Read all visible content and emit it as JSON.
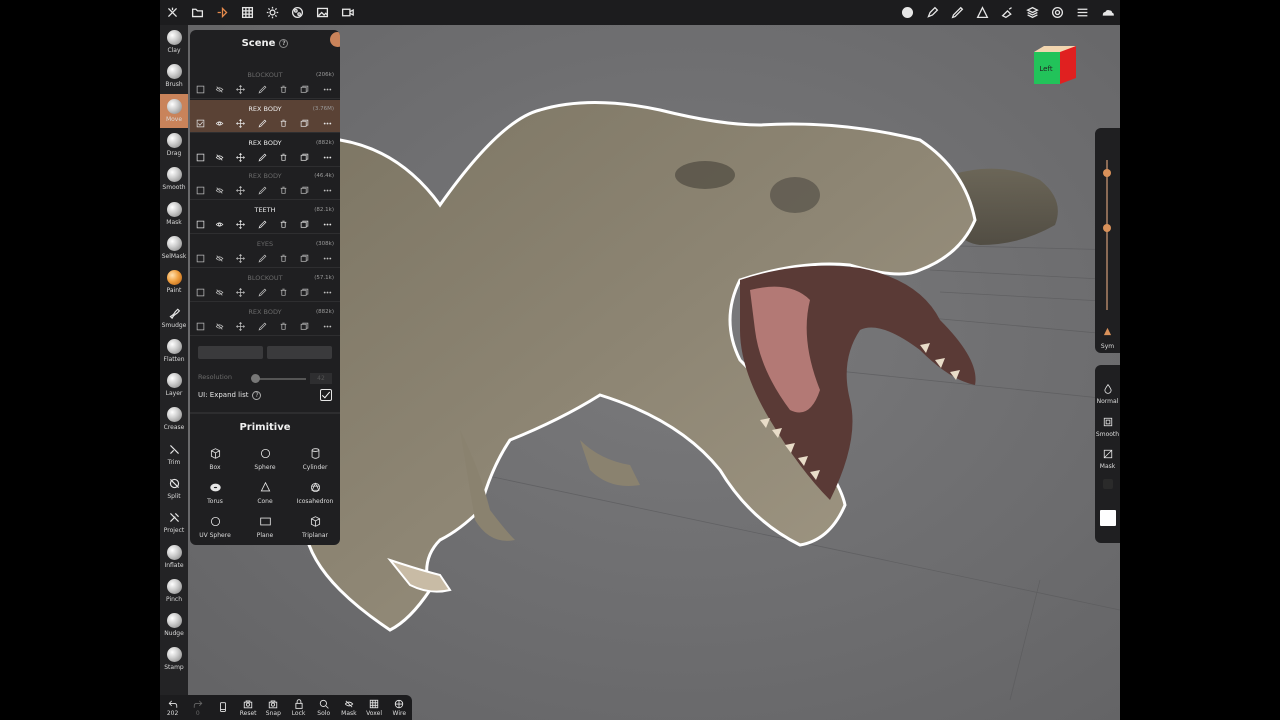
{
  "topbar": {
    "left_icons": [
      "tools-icon",
      "folder-icon",
      "scene-icon",
      "grid-icon",
      "sun-icon",
      "material-icon",
      "image-icon",
      "video-icon"
    ],
    "right_icons": [
      "moon-icon",
      "pen-icon",
      "pencil-icon",
      "triangle-icon",
      "brush-icon",
      "layers-icon",
      "settings-icon",
      "menu-icon",
      "cloud-icon"
    ]
  },
  "tools": [
    {
      "label": "Clay",
      "type": "ball"
    },
    {
      "label": "Brush",
      "type": "ball"
    },
    {
      "label": "Move",
      "type": "ball",
      "active": true
    },
    {
      "label": "Drag",
      "type": "ball"
    },
    {
      "label": "Smooth",
      "type": "ball"
    },
    {
      "label": "Mask",
      "type": "ball"
    },
    {
      "label": "SelMask",
      "type": "ball"
    },
    {
      "label": "Paint",
      "type": "orange"
    },
    {
      "label": "Smudge",
      "type": "glyph"
    },
    {
      "label": "Flatten",
      "type": "ball"
    },
    {
      "label": "Layer",
      "type": "ball"
    },
    {
      "label": "Crease",
      "type": "ball"
    },
    {
      "label": "Trim",
      "type": "glyph"
    },
    {
      "label": "Split",
      "type": "glyph"
    },
    {
      "label": "Project",
      "type": "glyph"
    },
    {
      "label": "Inflate",
      "type": "ball"
    },
    {
      "label": "Pinch",
      "type": "ball"
    },
    {
      "label": "Nudge",
      "type": "ball"
    },
    {
      "label": "Stamp",
      "type": "ball"
    }
  ],
  "scene": {
    "title": "Scene",
    "layers": [
      {
        "name": "BLOCKOUT",
        "count": "(206k)",
        "dim": true,
        "selected": false,
        "visible": false
      },
      {
        "name": "REX BODY",
        "count": "(3.76M)",
        "dim": false,
        "selected": true,
        "visible": true
      },
      {
        "name": "REX BODY",
        "count": "(882k)",
        "dim": false,
        "selected": false,
        "visible": false
      },
      {
        "name": "REX BODY",
        "count": "(46.4k)",
        "dim": true,
        "selected": false,
        "visible": false
      },
      {
        "name": "TEETH",
        "count": "(82.1k)",
        "dim": false,
        "selected": false,
        "visible": true
      },
      {
        "name": "EYES",
        "count": "(308k)",
        "dim": true,
        "selected": false,
        "visible": false
      },
      {
        "name": "BLOCKOUT",
        "count": "(57.1k)",
        "dim": true,
        "selected": false,
        "visible": false
      },
      {
        "name": "REX BODY",
        "count": "(882k)",
        "dim": true,
        "selected": false,
        "visible": false
      }
    ],
    "resolution_label": "Resolution",
    "resolution_value": "42",
    "resolution_level": 0.02,
    "expand_label": "UI: Expand list",
    "expand_checked": true
  },
  "primitive": {
    "title": "Primitive",
    "items": [
      {
        "label": "Box",
        "icon": "cube-icon"
      },
      {
        "label": "Sphere",
        "icon": "sphere-icon"
      },
      {
        "label": "Cylinder",
        "icon": "cylinder-icon"
      },
      {
        "label": "Torus",
        "icon": "torus-icon"
      },
      {
        "label": "Cone",
        "icon": "cone-icon"
      },
      {
        "label": "Icosahedron",
        "icon": "icosahedron-icon"
      },
      {
        "label": "UV Sphere",
        "icon": "uv-sphere-icon"
      },
      {
        "label": "Plane",
        "icon": "plane-icon"
      },
      {
        "label": "Triplanar",
        "icon": "triplanar-icon"
      }
    ]
  },
  "right_panel": {
    "slider_top_level": 0.97,
    "slider_bottom_level": 0.6,
    "sym_label": "Sym",
    "items": [
      {
        "label": "Normal",
        "icon": "drop-icon"
      },
      {
        "label": "Smooth",
        "icon": "smooth-square-icon"
      },
      {
        "label": "Mask",
        "icon": "mask-square-icon"
      }
    ]
  },
  "viewcube": {
    "left_label": "Left",
    "front_color": "#22c35a",
    "side_color": "#e02020",
    "top_color": "#f2d6b0"
  },
  "bottombar": [
    {
      "label": "202",
      "icon": "undo-icon",
      "dim": false
    },
    {
      "label": "0",
      "icon": "redo-icon",
      "dim": true
    },
    {
      "label": "",
      "icon": "phone-icon",
      "dim": false
    },
    {
      "label": "Reset",
      "icon": "reset-icon",
      "dim": false
    },
    {
      "label": "Snap",
      "icon": "snap-icon",
      "dim": false
    },
    {
      "label": "Lock",
      "icon": "lock-icon",
      "dim": false
    },
    {
      "label": "Solo",
      "icon": "solo-icon",
      "dim": false
    },
    {
      "label": "Mask",
      "icon": "mask-icon",
      "dim": false
    },
    {
      "label": "Voxel",
      "icon": "voxel-icon",
      "dim": false
    },
    {
      "label": "Wire",
      "icon": "wire-icon",
      "dim": false
    }
  ],
  "colors": {
    "accent": "#c9835a",
    "panel": "#1f1f21",
    "viewport": "#6e6e70",
    "selection_outline": "#ffffff"
  }
}
